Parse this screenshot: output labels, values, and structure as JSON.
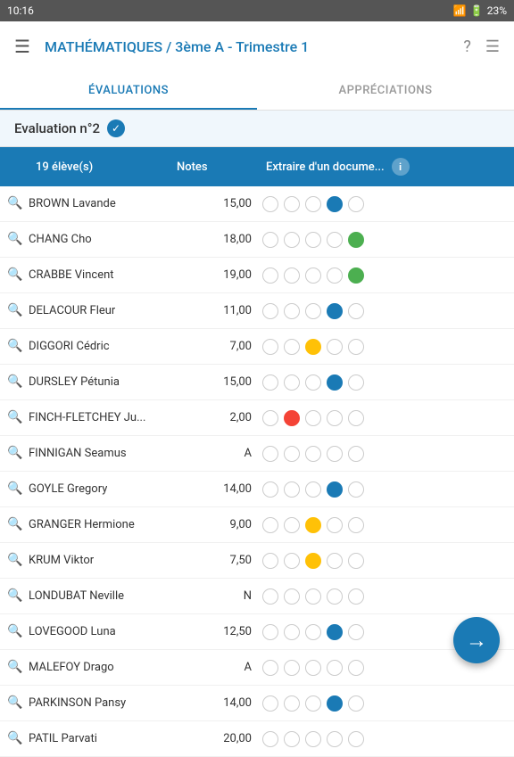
{
  "status_bar": {
    "time": "10:16",
    "battery": "23%",
    "icons": [
      "notification-off",
      "wifi"
    ]
  },
  "app_bar": {
    "title": "MATHÉMATIQUES / 3ème A - Trimestre 1",
    "menu_icon": "☰",
    "help_icon": "?",
    "filter_icon": "≡"
  },
  "tabs": [
    {
      "label": "ÉVALUATIONS",
      "active": true
    },
    {
      "label": "APPRÉCIATIONS",
      "active": false
    }
  ],
  "eval_header": {
    "text": "Evaluation n°2",
    "check": "✓"
  },
  "table_header": {
    "col1": "19 élève(s)",
    "col2": "Notes",
    "col3": "Extraire d'un docume...",
    "info": "i"
  },
  "students": [
    {
      "name": "BROWN Lavande",
      "note": "15,00",
      "circles": [
        "empty",
        "empty",
        "empty",
        "filled-blue",
        "empty"
      ]
    },
    {
      "name": "CHANG Cho",
      "note": "18,00",
      "circles": [
        "empty",
        "empty",
        "empty",
        "empty",
        "filled-green"
      ]
    },
    {
      "name": "CRABBE Vincent",
      "note": "19,00",
      "circles": [
        "empty",
        "empty",
        "empty",
        "empty",
        "filled-green"
      ]
    },
    {
      "name": "DELACOUR Fleur",
      "note": "11,00",
      "circles": [
        "empty",
        "empty",
        "empty",
        "filled-blue",
        "empty"
      ]
    },
    {
      "name": "DIGGORI Cédric",
      "note": "7,00",
      "circles": [
        "empty",
        "empty",
        "filled-yellow",
        "empty",
        "empty"
      ]
    },
    {
      "name": "DURSLEY Pétunia",
      "note": "15,00",
      "circles": [
        "empty",
        "empty",
        "empty",
        "filled-blue",
        "empty"
      ]
    },
    {
      "name": "FINCH-FLETCHEY Ju...",
      "note": "2,00",
      "circles": [
        "empty",
        "filled-red",
        "empty",
        "empty",
        "empty"
      ]
    },
    {
      "name": "FINNIGAN Seamus",
      "note": "A",
      "circles": [
        "empty",
        "empty",
        "empty",
        "empty",
        "empty"
      ]
    },
    {
      "name": "GOYLE Gregory",
      "note": "14,00",
      "circles": [
        "empty",
        "empty",
        "empty",
        "filled-blue",
        "empty"
      ]
    },
    {
      "name": "GRANGER Hermione",
      "note": "9,00",
      "circles": [
        "empty",
        "empty",
        "filled-yellow",
        "empty",
        "empty"
      ]
    },
    {
      "name": "KRUM Viktor",
      "note": "7,50",
      "circles": [
        "empty",
        "empty",
        "filled-yellow",
        "empty",
        "empty"
      ]
    },
    {
      "name": "LONDUBAT Neville",
      "note": "N",
      "circles": [
        "empty",
        "empty",
        "empty",
        "empty",
        "empty"
      ]
    },
    {
      "name": "LOVEGOOD Luna",
      "note": "12,50",
      "circles": [
        "empty",
        "empty",
        "empty",
        "filled-blue",
        "empty"
      ]
    },
    {
      "name": "MALEFOY Drago",
      "note": "A",
      "circles": [
        "empty",
        "empty",
        "empty",
        "empty",
        "empty"
      ]
    },
    {
      "name": "PARKINSON Pansy",
      "note": "14,00",
      "circles": [
        "empty",
        "empty",
        "empty",
        "filled-blue",
        "empty"
      ]
    },
    {
      "name": "PATIL Parvati",
      "note": "20,00",
      "circles": [
        "empty",
        "empty",
        "empty",
        "empty",
        "empty"
      ]
    }
  ],
  "fab": {
    "icon": "→"
  }
}
